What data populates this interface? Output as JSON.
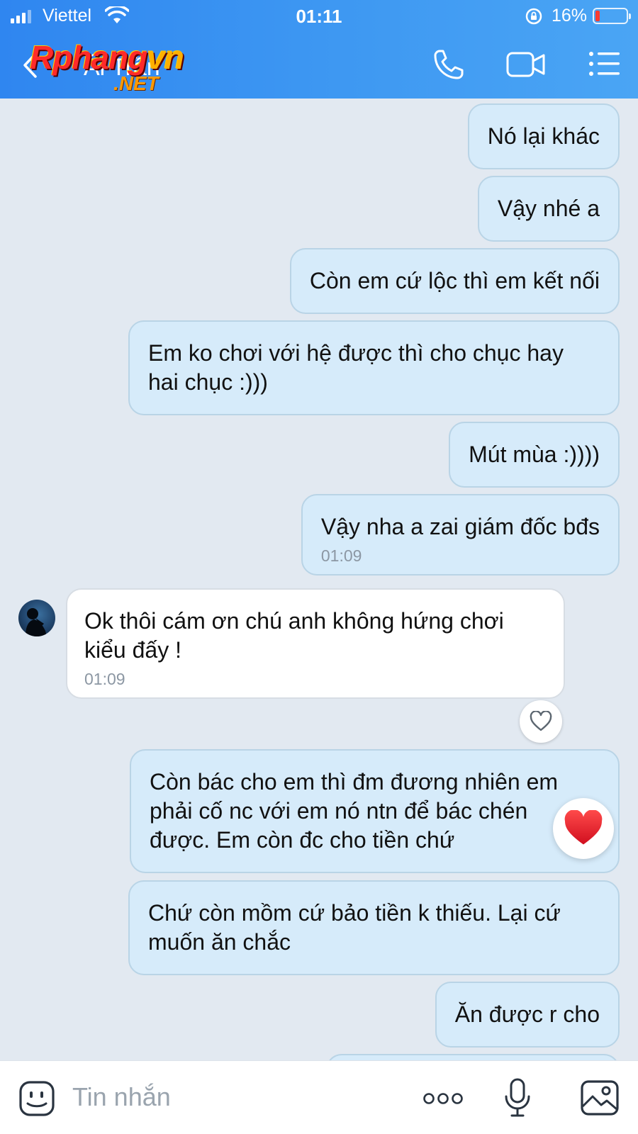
{
  "status": {
    "carrier": "Viettel",
    "time": "01:11",
    "battery": "16%",
    "battery_level": 0.16
  },
  "header": {
    "contact_name": "Ái Trần"
  },
  "watermark": {
    "main_a": "Rphang",
    "main_b": "vn",
    "sub": ".NET"
  },
  "messages": [
    {
      "side": "me",
      "text": "Nó lại khác"
    },
    {
      "side": "me",
      "text": "Vậy nhé a"
    },
    {
      "side": "me",
      "text": "Còn em cứ lộc thì em kết nối"
    },
    {
      "side": "me",
      "text": "Em ko chơi với hệ được thì cho chục hay\nhai chục :)))"
    },
    {
      "side": "me",
      "text": "Mút mùa :))))"
    },
    {
      "side": "me",
      "text": "Vậy nha a zai giám đốc bđs",
      "time": "01:09"
    },
    {
      "side": "them",
      "text": "Ok thôi cám ơn chú anh không hứng chơi\nkiểu đấy !",
      "time": "01:09"
    },
    {
      "side": "me",
      "text": "Còn bác cho em thì đm đương nhiên em\nphải cố nc với em nó ntn để bác chén\nđược. Em còn đc cho tiền chứ",
      "reaction": "heart"
    },
    {
      "side": "me",
      "text": "Chứ còn mồm cứ bảo tiền k thiếu. Lại cứ\nmuốn ăn chắc"
    },
    {
      "side": "me",
      "text": "Ăn được r cho"
    }
  ],
  "input": {
    "placeholder": "Tin nhắn"
  },
  "icons": [
    "wifi-icon",
    "back-icon",
    "phone-icon",
    "video-call-icon",
    "menu-icon",
    "heart-outline-icon",
    "heart-reaction-icon",
    "sticker-icon",
    "more-icon",
    "microphone-icon",
    "image-icon"
  ],
  "colors": {
    "header": "#3d97f2",
    "my_bubble": "#d6ebfa",
    "their_bubble": "#ffffff",
    "background": "#e2e9f1"
  }
}
